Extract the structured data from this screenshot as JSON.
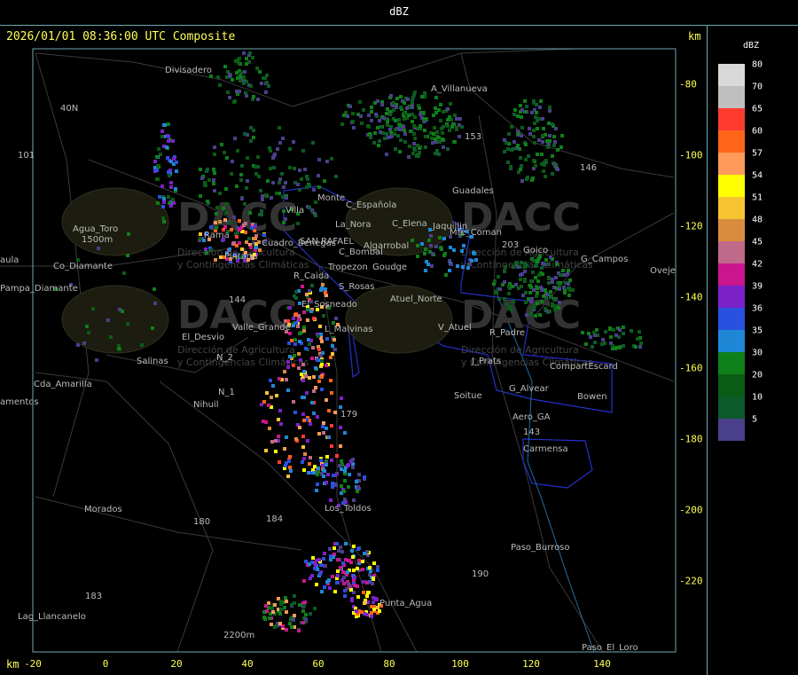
{
  "window_title": "dBZ",
  "header": {
    "timestamp_line": "2026/01/01 08:36:00 UTC Composite",
    "km_label_top": "km",
    "km_label_bottom": "km"
  },
  "axes": {
    "x_ticks": [
      "-20",
      "0",
      "20",
      "40",
      "60",
      "80",
      "100",
      "120",
      "140"
    ],
    "y_ticks": [
      "-80",
      "-100",
      "-120",
      "-140",
      "-160",
      "-180",
      "-200",
      "-220"
    ]
  },
  "legend": {
    "title": "dBZ",
    "entries": [
      {
        "label": "80",
        "color": "#d9d9d9"
      },
      {
        "label": "70",
        "color": "#bfbfbf"
      },
      {
        "label": "65",
        "color": "#ff3b2f"
      },
      {
        "label": "60",
        "color": "#ff6418"
      },
      {
        "label": "57",
        "color": "#ff9a5a"
      },
      {
        "label": "54",
        "color": "#ffff00"
      },
      {
        "label": "51",
        "color": "#f7c431"
      },
      {
        "label": "48",
        "color": "#d98c3e"
      },
      {
        "label": "45",
        "color": "#c06a8a"
      },
      {
        "label": "42",
        "color": "#c9168f"
      },
      {
        "label": "39",
        "color": "#7a22c8"
      },
      {
        "label": "36",
        "color": "#2851e0"
      },
      {
        "label": "35",
        "color": "#1e88d6"
      },
      {
        "label": "30",
        "color": "#0f7f1a"
      },
      {
        "label": "20",
        "color": "#0a5c14"
      },
      {
        "label": "10",
        "color": "#0d5a2a"
      },
      {
        "label": "5",
        "color": "#4a3f8a"
      }
    ]
  },
  "watermark": {
    "brand": "DACC",
    "subtitle_line1": "Dirección de Agricultura",
    "subtitle_line2": "y Contingencias Climáticas"
  },
  "places": [
    {
      "name": "Divisadero"
    },
    {
      "name": "A_Villanueva"
    },
    {
      "name": "40N"
    },
    {
      "name": "101"
    },
    {
      "name": "Guadales"
    },
    {
      "name": "Agua_Toro"
    },
    {
      "name": "1500m"
    },
    {
      "name": "Co_Diamante"
    },
    {
      "name": "Pampa_Diamante"
    },
    {
      "name": "El_Desvio"
    },
    {
      "name": "Salinas"
    },
    {
      "name": "Cda_Amarilla"
    },
    {
      "name": "amentos"
    },
    {
      "name": "Nihuil"
    },
    {
      "name": "N_1"
    },
    {
      "name": "N_2"
    },
    {
      "name": "Valle_Grande"
    },
    {
      "name": "SAN RAFAEL"
    },
    {
      "name": "La_Nora"
    },
    {
      "name": "Monte"
    },
    {
      "name": "C_Española"
    },
    {
      "name": "C_Elena"
    },
    {
      "name": "Jaquillin"
    },
    {
      "name": "Mte_Coman"
    },
    {
      "name": "Goico"
    },
    {
      "name": "G_Campos"
    },
    {
      "name": "Cuadro_Benegas"
    },
    {
      "name": "C_Bombal"
    },
    {
      "name": "Algarrobal"
    },
    {
      "name": "Tropezon"
    },
    {
      "name": "Goudge"
    },
    {
      "name": "R_Caida"
    },
    {
      "name": "S_Rosas"
    },
    {
      "name": "El_Sosneado"
    },
    {
      "name": "Atuel_Norte"
    },
    {
      "name": "V_Atuel"
    },
    {
      "name": "R_Padre"
    },
    {
      "name": "L_Malvinas"
    },
    {
      "name": "J_Prats"
    },
    {
      "name": "CompartEscard"
    },
    {
      "name": "G_Alvear"
    },
    {
      "name": "Bowen"
    },
    {
      "name": "Soitue"
    },
    {
      "name": "Aero_GA"
    },
    {
      "name": "Carmensa"
    },
    {
      "name": "Los_Toldos"
    },
    {
      "name": "Morados"
    },
    {
      "name": "Paso_Burroso"
    },
    {
      "name": "Punta_Agua"
    },
    {
      "name": "Lag_Llancanelo"
    },
    {
      "name": "Paso_El_Loro"
    },
    {
      "name": "Oveje"
    },
    {
      "name": "2200m"
    },
    {
      "name": "Pintada"
    },
    {
      "name": "Rama"
    },
    {
      "name": "aula"
    },
    {
      "name": "Villa"
    },
    {
      "name": "143"
    },
    {
      "name": "146"
    },
    {
      "name": "153"
    },
    {
      "name": "144"
    },
    {
      "name": "179"
    },
    {
      "name": "180"
    },
    {
      "name": "183"
    },
    {
      "name": "184"
    },
    {
      "name": "190"
    },
    {
      "name": "203"
    }
  ]
}
